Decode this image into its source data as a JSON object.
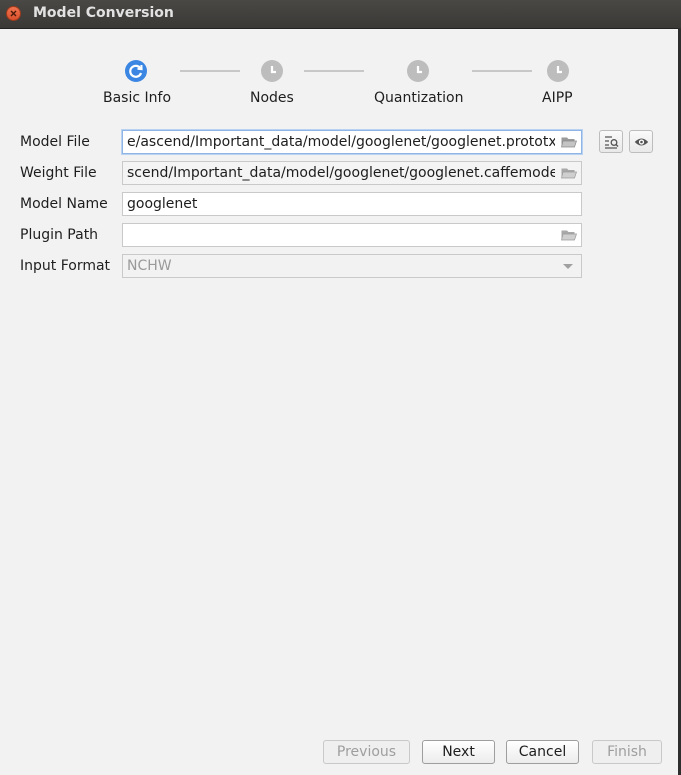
{
  "window": {
    "title": "Model Conversion"
  },
  "steps": [
    {
      "label": "Basic Info",
      "state": "active"
    },
    {
      "label": "Nodes",
      "state": "inactive"
    },
    {
      "label": "Quantization",
      "state": "inactive"
    },
    {
      "label": "AIPP",
      "state": "inactive"
    }
  ],
  "form": {
    "model_file": {
      "label": "Model File",
      "value": "e/ascend/Important_data/model/googlenet/googlenet.prototxt"
    },
    "weight_file": {
      "label": "Weight File",
      "value": "scend/Important_data/model/googlenet/googlenet.caffemodel"
    },
    "model_name": {
      "label": "Model Name",
      "value": "googlenet"
    },
    "plugin_path": {
      "label": "Plugin Path",
      "value": ""
    },
    "input_format": {
      "label": "Input Format",
      "value": "NCHW"
    }
  },
  "buttons": {
    "previous": "Previous",
    "next": "Next",
    "cancel": "Cancel",
    "finish": "Finish"
  },
  "colors": {
    "accent": "#3b86e3",
    "inactive_step": "#bdbdbd",
    "titlebar": "#3e3d3a"
  }
}
